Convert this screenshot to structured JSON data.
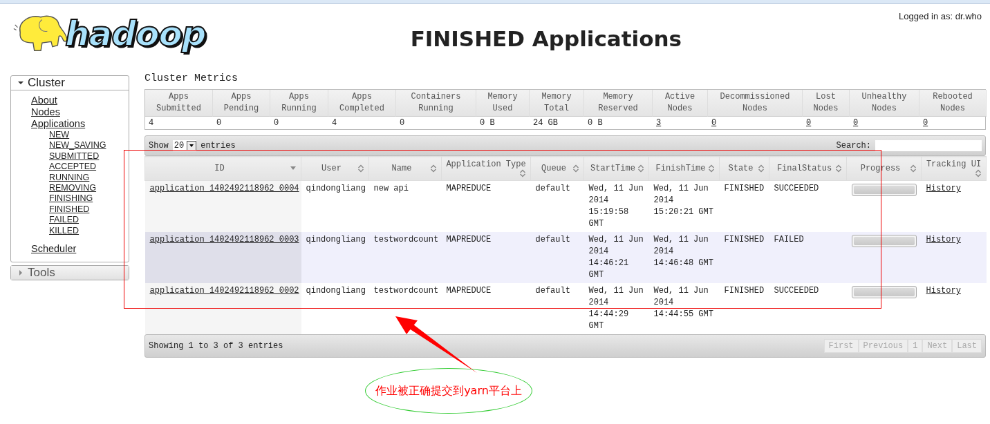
{
  "header": {
    "logo_text": "hadoop",
    "title": "FINISHED Applications",
    "login": "Logged in as: dr.who"
  },
  "sidebar": [
    {
      "label": "Cluster",
      "expanded": true,
      "children": [
        {
          "label": "About"
        },
        {
          "label": "Nodes"
        },
        {
          "label": "Applications",
          "children": [
            {
              "label": "NEW"
            },
            {
              "label": "NEW_SAVING"
            },
            {
              "label": "SUBMITTED"
            },
            {
              "label": "ACCEPTED"
            },
            {
              "label": "RUNNING"
            },
            {
              "label": "REMOVING"
            },
            {
              "label": "FINISHING"
            },
            {
              "label": "FINISHED"
            },
            {
              "label": "FAILED"
            },
            {
              "label": "KILLED"
            }
          ]
        },
        {
          "label": "Scheduler"
        }
      ]
    },
    {
      "label": "Tools",
      "expanded": false
    }
  ],
  "metrics": {
    "title": "Cluster Metrics",
    "columns": [
      {
        "label": "Apps Submitted",
        "value": "4",
        "link": false
      },
      {
        "label": "Apps Pending",
        "value": "0",
        "link": false
      },
      {
        "label": "Apps Running",
        "value": "0",
        "link": false
      },
      {
        "label": "Apps Completed",
        "value": "4",
        "link": false
      },
      {
        "label": "Containers Running",
        "value": "0",
        "link": false
      },
      {
        "label": "Memory Used",
        "value": "0 B",
        "link": false
      },
      {
        "label": "Memory Total",
        "value": "24 GB",
        "link": false
      },
      {
        "label": "Memory Reserved",
        "value": "0 B",
        "link": false
      },
      {
        "label": "Active Nodes",
        "value": "3",
        "link": true
      },
      {
        "label": "Decommissioned Nodes",
        "value": "0",
        "link": true
      },
      {
        "label": "Lost Nodes",
        "value": "0",
        "link": true
      },
      {
        "label": "Unhealthy Nodes",
        "value": "0",
        "link": true
      },
      {
        "label": "Rebooted Nodes",
        "value": "0",
        "link": true
      }
    ]
  },
  "table": {
    "show_label": "Show",
    "page_size": "20",
    "entries_label": "entries",
    "search_label": "Search:",
    "columns": [
      {
        "label": "ID",
        "sorted": true
      },
      {
        "label": "User",
        "sorted": false
      },
      {
        "label": "Name",
        "sorted": false
      },
      {
        "label": "Application Type",
        "sorted": false
      },
      {
        "label": "Queue",
        "sorted": false
      },
      {
        "label": "StartTime",
        "sorted": false
      },
      {
        "label": "FinishTime",
        "sorted": false
      },
      {
        "label": "State",
        "sorted": false
      },
      {
        "label": "FinalStatus",
        "sorted": false
      },
      {
        "label": "Progress",
        "sorted": false
      },
      {
        "label": "Tracking UI",
        "sorted": false
      }
    ],
    "rows": [
      {
        "selected": false,
        "id": "application_1402492118962_0004",
        "user": "qindongliang",
        "name": "new api",
        "type": "MAPREDUCE",
        "queue": "default",
        "start": "Wed, 11 Jun 2014 15:19:58 GMT",
        "finish": "Wed, 11 Jun 2014 15:20:21 GMT",
        "state": "FINISHED",
        "final_status": "SUCCEEDED",
        "progress": {
          "level": 1
        },
        "tracking": "History"
      },
      {
        "selected": true,
        "id": "application_1402492118962_0003",
        "user": "qindongliang",
        "name": "testwordcount",
        "type": "MAPREDUCE",
        "queue": "default",
        "start": "Wed, 11 Jun 2014 14:46:21 GMT",
        "finish": "Wed, 11 Jun 2014 14:46:48 GMT",
        "state": "FINISHED",
        "final_status": "FAILED",
        "progress": {
          "level": 1
        },
        "tracking": "History"
      },
      {
        "selected": false,
        "id": "application_1402492118962_0002",
        "user": "qindongliang",
        "name": "testwordcount",
        "type": "MAPREDUCE",
        "queue": "default",
        "start": "Wed, 11 Jun 2014 14:44:29 GMT",
        "finish": "Wed, 11 Jun 2014 14:44:55 GMT",
        "state": "FINISHED",
        "final_status": "SUCCEEDED",
        "progress": {
          "level": 1
        },
        "tracking": "History"
      }
    ],
    "info": "Showing 1 to 3 of 3 entries",
    "pagination": [
      {
        "label": "First",
        "disabled": true
      },
      {
        "label": "Previous",
        "disabled": true
      },
      {
        "label": "1",
        "disabled": true
      },
      {
        "label": "Next",
        "disabled": true
      },
      {
        "label": "Last",
        "disabled": true
      }
    ]
  },
  "annotation": {
    "text": "作业被正确提交到yarn平台上"
  }
}
